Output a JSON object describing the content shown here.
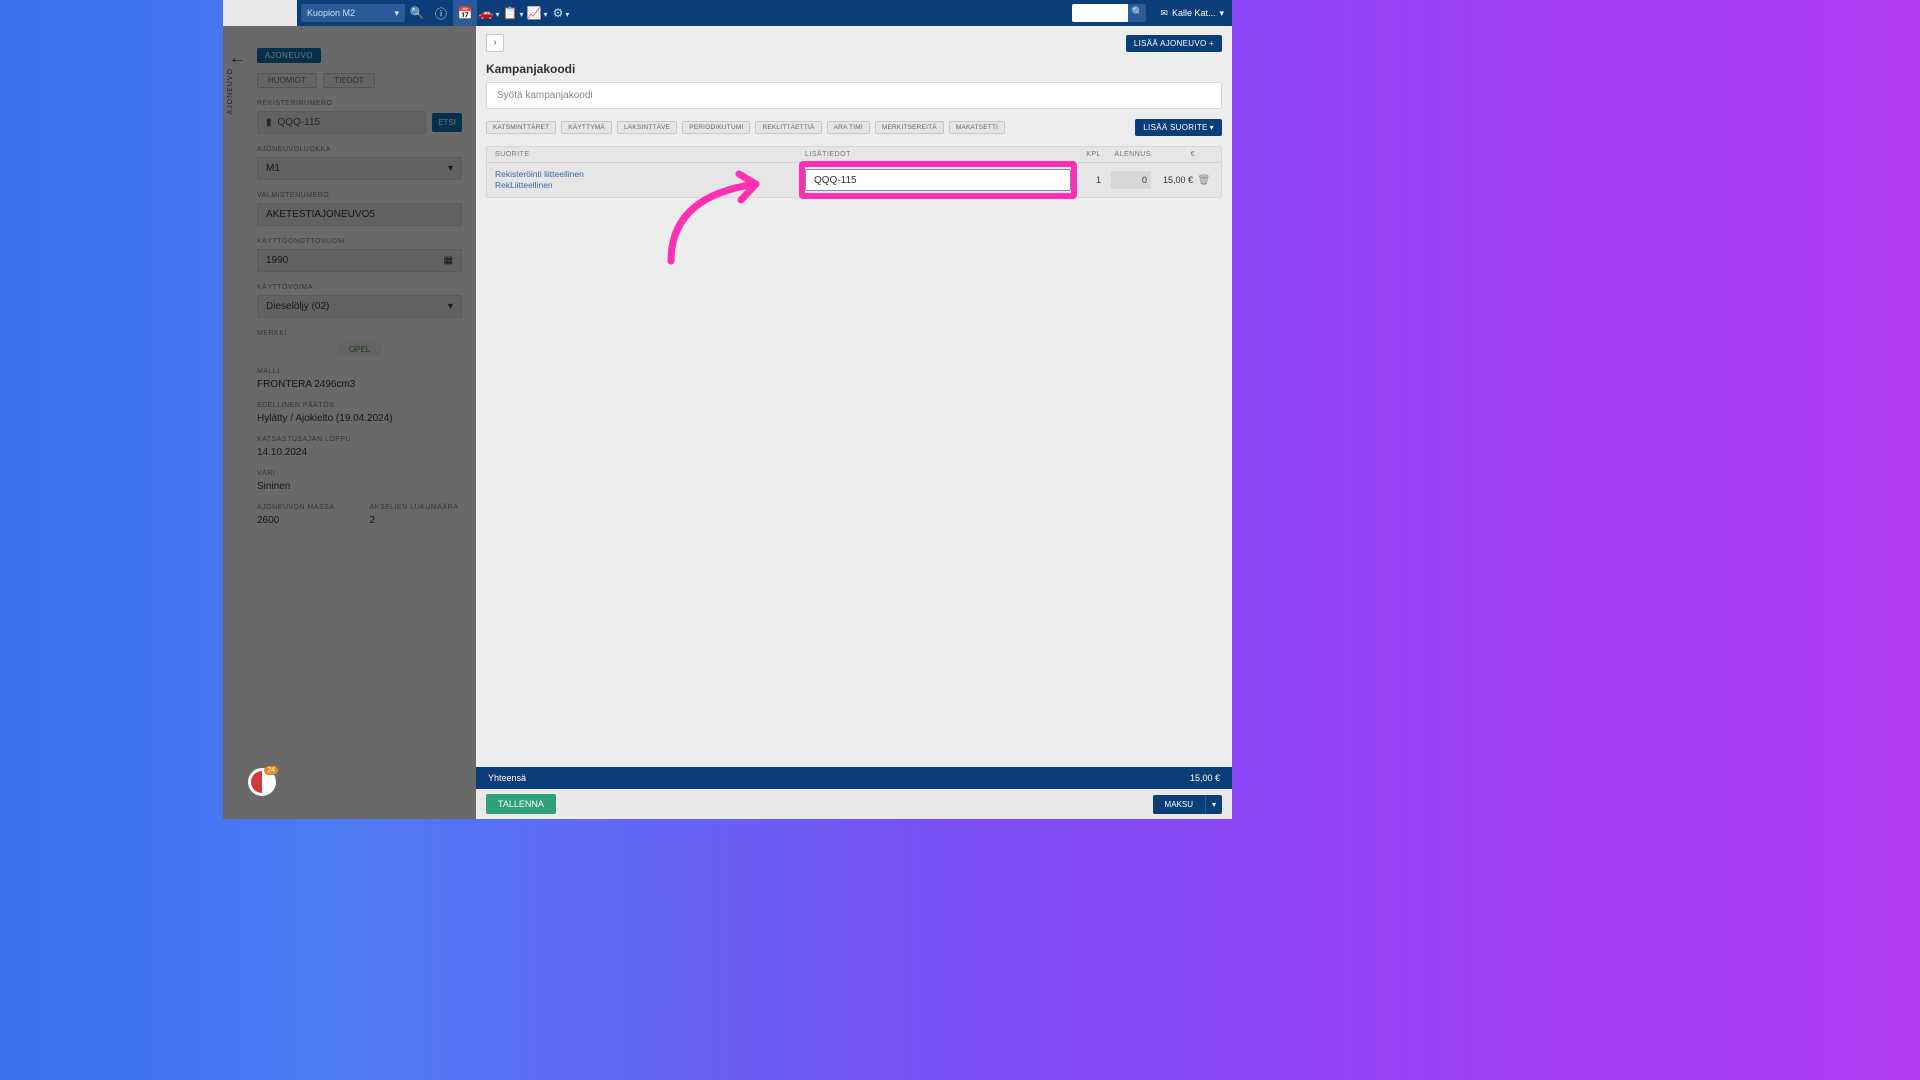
{
  "header": {
    "location": "Kuopion M2",
    "user": "Kalle Kat...",
    "icons": [
      "search",
      "info",
      "calendar",
      "car",
      "clipboard",
      "chart",
      "gear"
    ]
  },
  "sidebar": {
    "active_pill": "AJONEUVO",
    "tabs": [
      "HUOMIOT",
      "TIEDOT"
    ],
    "reg_label": "REKISTERINUMERO",
    "reg_value": "QQQ-115",
    "reg_button": "ETSI",
    "fields": {
      "ajoneuvoluokka": {
        "label": "AJONEUVOLUOKKA",
        "value": "M1"
      },
      "valmistenumero": {
        "label": "VALMISTENUMERO",
        "value": "AKETESTIAJONEUVO5"
      },
      "kayttoonottovuosi": {
        "label": "KÄYTTÖÖNOTTOVUOSI",
        "value": "1990"
      },
      "kayttovoima": {
        "label": "KÄYTTÖVOIMA",
        "value": "Dieselöljy (02)"
      },
      "merkki": {
        "label": "MERKKI",
        "value": "OPEL"
      },
      "malli": {
        "label": "MALLI",
        "value": "FRONTERA 2496cm3"
      },
      "edellinen_paatos": {
        "label": "EDELLINEN PÄÄTÖS",
        "value": "Hylätty / Ajokielto (19.04.2024)"
      },
      "katsastusajan_loppu": {
        "label": "KATSASTUSAJAN LOPPU",
        "value": "14.10.2024"
      },
      "vari": {
        "label": "VÄRI",
        "value": "Sininen"
      },
      "massa": {
        "label": "AJONEUVON MASSA",
        "value": "2600"
      },
      "akselit": {
        "label": "AKSELIEN LUKUMÄÄRÄ",
        "value": "2"
      }
    }
  },
  "main": {
    "add_vehicle": "LISÄÄ AJONEUVO +",
    "heading": "Kampanjakoodi",
    "campaign_placeholder": "Syötä kampanjakoodi",
    "tags": [
      "KATSMINTTÄRET",
      "KÄYTTYMÄ",
      "LAKSINTTÄVE",
      "PERIODIKUTUMI",
      "REKLITTÄETTIÄ",
      "ARA TIMI",
      "MERKITSEREITÄ",
      "MAKATSETTI"
    ],
    "add_item": "LISÄÄ SUORITE",
    "table": {
      "columns": {
        "suorite": "SUORITE",
        "lisatiedot": "LISÄTIEDOT",
        "kpl": "KPL",
        "alennus": "ALENNUS",
        "eur": "€"
      },
      "row": {
        "desc_line1": "Rekisteröinti liitteellinen",
        "desc_line2": "RekLiitteellinen",
        "lisatiedot": "QQQ-115",
        "kpl": "1",
        "alennus": "0",
        "eur": "15,00 €"
      }
    }
  },
  "footer": {
    "total_label": "Yhteensä",
    "total_value": "15,00 €",
    "save": "TALLENNA",
    "pay": "MAKSU"
  }
}
